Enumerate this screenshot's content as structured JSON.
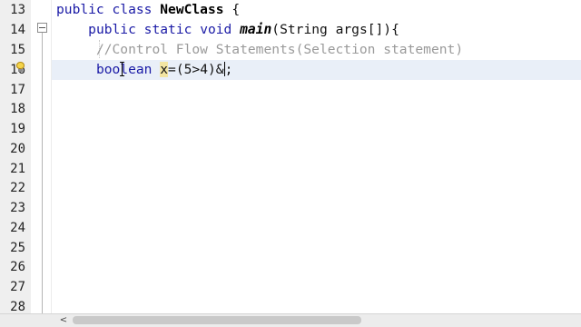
{
  "gutter": {
    "line_numbers": [
      "13",
      "14",
      "15",
      "16",
      "17",
      "18",
      "19",
      "20",
      "21",
      "22",
      "23",
      "24",
      "25",
      "26",
      "27",
      "28"
    ]
  },
  "code": {
    "line13": {
      "kw_public": "public",
      "kw_class": "class",
      "class_name": "NewClass",
      "brace": "{"
    },
    "line14": {
      "kw_public": "public",
      "kw_static": "static",
      "kw_void": "void",
      "method": "main",
      "params": "(String args[]){"
    },
    "line15": {
      "comment": "//Control Flow Statements(Selection statement)"
    },
    "line16": {
      "kw_boolean": "boolean",
      "var": "x",
      "expr_before_caret": "=(5>4)&",
      "expr_after_caret": ";"
    }
  },
  "scrollbar": {
    "left_arrow": "<"
  },
  "icons": {
    "fold": "fold-collapse-icon",
    "hint": "lightbulb-hint-icon",
    "cursor": "text-cursor-ibeam-icon"
  }
}
